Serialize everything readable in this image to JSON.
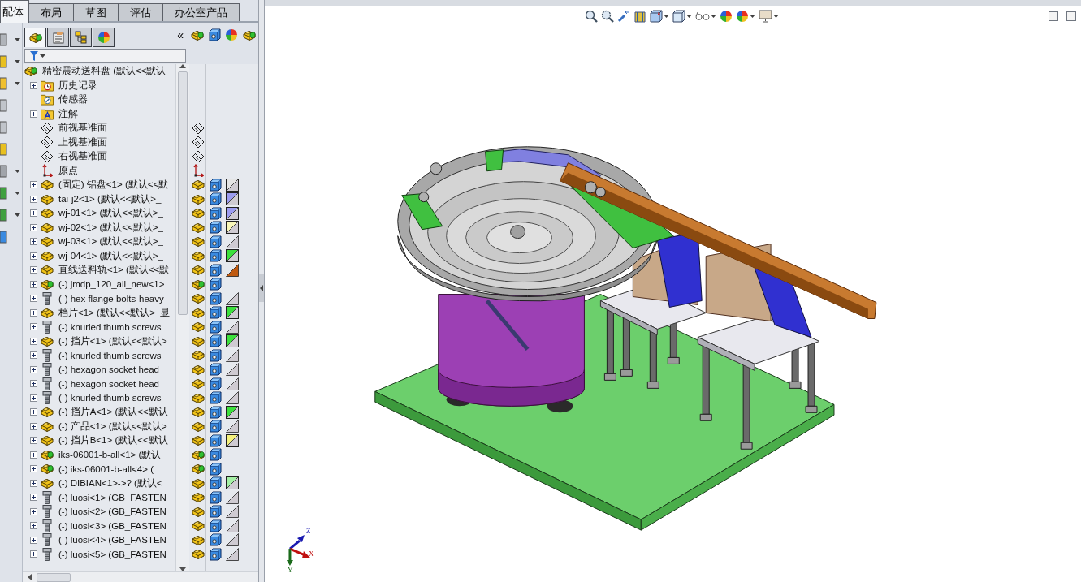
{
  "command_tabs": [
    {
      "label": "配体",
      "selected": true
    },
    {
      "label": "布局",
      "selected": false
    },
    {
      "label": "草图",
      "selected": false
    },
    {
      "label": "评估",
      "selected": false
    },
    {
      "label": "办公室产品",
      "selected": false
    }
  ],
  "panel_tabs": [
    {
      "kind": "feature-manager",
      "selected": true
    },
    {
      "kind": "property-manager",
      "selected": false
    },
    {
      "kind": "configuration-manager",
      "selected": false
    },
    {
      "kind": "display-manager",
      "selected": false
    }
  ],
  "collapse_button": "«",
  "tree": {
    "root": {
      "label": "精密震动送料盘  (默认<<默认",
      "children": [
        {
          "label": "历史记录",
          "kind": "history",
          "expandable": true
        },
        {
          "label": "传感器",
          "kind": "sensors",
          "expandable": false
        },
        {
          "label": "注解",
          "kind": "annotations",
          "expandable": true
        },
        {
          "label": "前视基准面",
          "kind": "plane",
          "expandable": false
        },
        {
          "label": "上视基准面",
          "kind": "plane",
          "expandable": false
        },
        {
          "label": "右视基准面",
          "kind": "plane",
          "expandable": false
        },
        {
          "label": "原点",
          "kind": "origin",
          "expandable": false
        },
        {
          "label": "(固定) 铝盘<1> (默认<<默",
          "kind": "part",
          "expandable": true,
          "appearance": {
            "kind": "split",
            "color": "#e4e4e4"
          }
        },
        {
          "label": "tai-j2<1> (默认<<默认>_",
          "kind": "part",
          "expandable": true,
          "appearance": {
            "kind": "split",
            "color": "#9c9cf0"
          }
        },
        {
          "label": "wj-01<1> (默认<<默认>_",
          "kind": "part",
          "expandable": true,
          "appearance": {
            "kind": "split",
            "color": "#9c9cf0"
          }
        },
        {
          "label": "wj-02<1> (默认<<默认>_",
          "kind": "part",
          "expandable": true,
          "appearance": {
            "kind": "split",
            "color": "#f8f6b8"
          }
        },
        {
          "label": "wj-03<1> (默认<<默认>_",
          "kind": "part",
          "expandable": true,
          "appearance": {
            "kind": "plain"
          }
        },
        {
          "label": "wj-04<1> (默认<<默认>_",
          "kind": "part",
          "expandable": true,
          "appearance": {
            "kind": "split",
            "color": "#3ce03c"
          }
        },
        {
          "label": "直线送料轨<1> (默认<<默",
          "kind": "part",
          "expandable": true,
          "appearance": {
            "kind": "solid",
            "color": "#c05a10"
          }
        },
        {
          "label": "(-) jmdp_120_all_new<1>",
          "kind": "assembly",
          "expandable": true
        },
        {
          "label": "(-) hex flange bolts-heavy",
          "kind": "fastener",
          "expandable": true,
          "appearance": {
            "kind": "plain"
          }
        },
        {
          "label": "档片<1> (默认<<默认>_显",
          "kind": "part",
          "expandable": true,
          "appearance": {
            "kind": "split",
            "color": "#3ce03c"
          }
        },
        {
          "label": "(-) knurled thumb screws",
          "kind": "fastener",
          "expandable": true,
          "appearance": {
            "kind": "plain"
          }
        },
        {
          "label": "(-) 挡片<1> (默认<<默认>",
          "kind": "part",
          "expandable": true,
          "appearance": {
            "kind": "split",
            "color": "#3ce03c"
          }
        },
        {
          "label": "(-) knurled thumb screws",
          "kind": "fastener",
          "expandable": true,
          "appearance": {
            "kind": "plain"
          }
        },
        {
          "label": "(-) hexagon socket head",
          "kind": "fastener",
          "expandable": true,
          "appearance": {
            "kind": "plain"
          }
        },
        {
          "label": "(-) hexagon socket head",
          "kind": "fastener",
          "expandable": true,
          "appearance": {
            "kind": "plain"
          }
        },
        {
          "label": "(-) knurled thumb screws",
          "kind": "fastener",
          "expandable": true,
          "appearance": {
            "kind": "plain"
          }
        },
        {
          "label": "(-) 挡片A<1> (默认<<默认",
          "kind": "part",
          "expandable": true,
          "appearance": {
            "kind": "split",
            "color": "#3ce03c"
          }
        },
        {
          "label": "(-) 产品<1> (默认<<默认>",
          "kind": "part",
          "expandable": true,
          "appearance": {
            "kind": "plain"
          }
        },
        {
          "label": "(-) 挡片B<1> (默认<<默认",
          "kind": "part",
          "expandable": true,
          "appearance": {
            "kind": "split",
            "color": "#f4f07c"
          }
        },
        {
          "label": "iks-06001-b-all<1> (默认",
          "kind": "assembly",
          "expandable": true
        },
        {
          "label": "(-) iks-06001-b-all<4> (",
          "kind": "assembly",
          "expandable": true
        },
        {
          "label": "(-) DIBIAN<1>->? (默认<",
          "kind": "part",
          "expandable": true,
          "appearance": {
            "kind": "split",
            "color": "#a4f0a4"
          }
        },
        {
          "label": "(-) luosi<1> (GB_FASTEN",
          "kind": "fastener",
          "expandable": true,
          "appearance": {
            "kind": "plain"
          }
        },
        {
          "label": "(-) luosi<2> (GB_FASTEN",
          "kind": "fastener",
          "expandable": true,
          "appearance": {
            "kind": "plain"
          }
        },
        {
          "label": "(-) luosi<3> (GB_FASTEN",
          "kind": "fastener",
          "expandable": true,
          "appearance": {
            "kind": "plain"
          }
        },
        {
          "label": "(-) luosi<4> (GB_FASTEN",
          "kind": "fastener",
          "expandable": true,
          "appearance": {
            "kind": "plain"
          }
        },
        {
          "label": "(-) luosi<5> (GB_FASTEN",
          "kind": "fastener",
          "expandable": true,
          "appearance": {
            "kind": "plain"
          }
        }
      ]
    }
  },
  "triad": {
    "x_label": "X",
    "y_label": "Y",
    "z_label": "Z"
  }
}
